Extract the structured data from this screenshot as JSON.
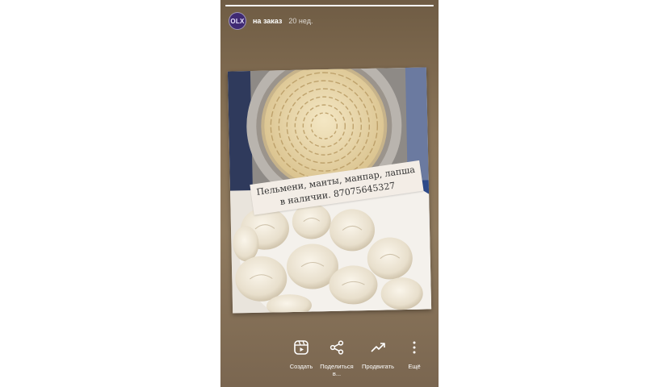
{
  "story": {
    "progress": 1.0,
    "avatar_text": "OLX",
    "username": "на заказ",
    "time": "20 нед.",
    "caption": "Пельмени, манты, манпар, лапша в наличии. 87075645327"
  },
  "actions": [
    {
      "label": "Создать",
      "icon": "reels-icon"
    },
    {
      "label": "Поделиться в...",
      "icon": "share-icon"
    },
    {
      "label": "Продвигать",
      "icon": "trend-icon"
    },
    {
      "label": "Ещё",
      "icon": "more-icon"
    }
  ],
  "colors": {
    "story_bg": "#8a7458",
    "avatar_bg": "#3f2a73"
  }
}
